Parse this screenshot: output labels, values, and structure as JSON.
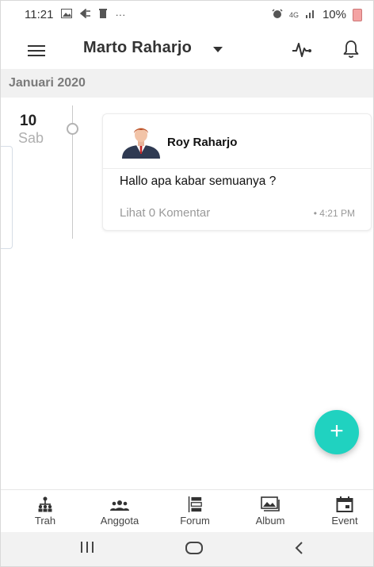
{
  "status_bar": {
    "time": "11:21",
    "notification_dots": "···",
    "network": "4G",
    "battery": "10%"
  },
  "app_bar": {
    "title": "Marto Raharjo"
  },
  "section": {
    "month_label": "Januari 2020"
  },
  "timeline": {
    "day_number": "10",
    "day_name": "Sab"
  },
  "post": {
    "author": "Roy Raharjo",
    "text": "Hallo apa kabar semuanya ?",
    "comments_label": "Lihat 0 Komentar",
    "time": "• 4:21 PM"
  },
  "fab": {
    "label": "+"
  },
  "bottom_nav": {
    "items": [
      {
        "label": "Trah",
        "icon": "family-tree-icon"
      },
      {
        "label": "Anggota",
        "icon": "members-icon"
      },
      {
        "label": "Forum",
        "icon": "forum-icon"
      },
      {
        "label": "Album",
        "icon": "album-icon"
      },
      {
        "label": "Event",
        "icon": "event-icon"
      }
    ]
  },
  "colors": {
    "fab": "#20d2c0",
    "section_bg": "#f1f1f1",
    "muted_text": "#999999"
  }
}
